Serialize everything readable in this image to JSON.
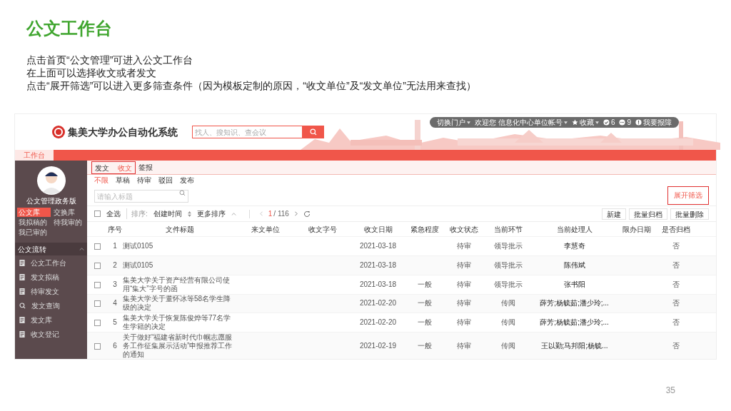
{
  "slide": {
    "title": "公文工作台",
    "lines": [
      "点击首页“公文管理”可进入公文工作台",
      "在上面可以选择收文或者发文",
      "点击“展开筛选”可以进入更多筛查条件（因为模板定制的原因，“收文单位”及“发文单位”无法用来查找）"
    ],
    "page_number": "35"
  },
  "app": {
    "logo_title": "集美大学办公自动化系统",
    "search": {
      "placeholder": "找人、搜知识、查会议"
    },
    "top_bar": [
      {
        "kind": "menu",
        "label": "切换门户"
      },
      {
        "kind": "menu",
        "label": "欢迎您 信息化中心单位帐号"
      },
      {
        "kind": "star",
        "label": "收藏"
      },
      {
        "kind": "check",
        "label": "6"
      },
      {
        "kind": "chat",
        "label": "9"
      },
      {
        "kind": "info",
        "label": "我要报障"
      }
    ],
    "nav_tabs": [
      {
        "label": "工作台",
        "selected": true
      }
    ],
    "sidebar": {
      "user_name": "公文管理政务版",
      "quick": [
        {
          "label": "公文库",
          "selected": true
        },
        {
          "label": "交换库",
          "selected": false
        },
        {
          "label": "我拟稿的",
          "selected": false
        },
        {
          "label": "待我审的",
          "selected": false
        },
        {
          "label": "我已审的",
          "selected": false
        }
      ],
      "section": {
        "label": "公文流转",
        "expanded": true
      },
      "items": [
        "公文工作台",
        "发文拟稿",
        "待审发文",
        "发文查询",
        "发文库",
        "收文登记"
      ]
    },
    "doc_tabs": [
      {
        "label": "发文",
        "selected": false
      },
      {
        "label": "收文",
        "selected": true
      },
      {
        "label": "签报",
        "selected": false
      }
    ],
    "filters": [
      {
        "label": "不限",
        "selected": true
      },
      {
        "label": "草稿",
        "selected": false
      },
      {
        "label": "待审",
        "selected": false
      },
      {
        "label": "驳回",
        "selected": false
      },
      {
        "label": "发布",
        "selected": false
      }
    ],
    "title_search": {
      "placeholder": "请输入标题"
    },
    "expand_filter": "展开筛选",
    "toolbar": {
      "select_all": {
        "label": "全选",
        "checked": false
      },
      "sort_label": "排序:",
      "sort_field": "创建时间",
      "more_sort": "更多排序",
      "page_current": "1",
      "page_total": "/ 116",
      "buttons": [
        "新建",
        "批量归档",
        "批量删除"
      ]
    },
    "table": {
      "columns": [
        "序号",
        "文件标题",
        "来文单位",
        "收文字号",
        "收文日期",
        "紧急程度",
        "收文状态",
        "当前环节",
        "当前处理人",
        "限办日期",
        "是否归档"
      ],
      "rows": [
        {
          "checked": false,
          "cells": [
            "1",
            "测试0105",
            "",
            "",
            "2021-03-18",
            "",
            "待审",
            "领导批示",
            "李慧奇",
            "",
            "否"
          ]
        },
        {
          "checked": false,
          "cells": [
            "2",
            "测试0105",
            "",
            "",
            "2021-03-18",
            "",
            "待审",
            "领导批示",
            "陈伟斌",
            "",
            "否"
          ]
        },
        {
          "checked": false,
          "cells": [
            "3",
            "集美大学关于资产经营有限公司使用“集大”字号的函",
            "",
            "",
            "2021-03-18",
            "一般",
            "待审",
            "领导批示",
            "张书阳",
            "",
            "否"
          ]
        },
        {
          "checked": false,
          "cells": [
            "4",
            "集美大学关于董怀冰等58名学生降级的决定",
            "",
            "",
            "2021-02-20",
            "一般",
            "待审",
            "传阅",
            "薛芳;杨毓茹;潘少玲;...",
            "",
            "否"
          ]
        },
        {
          "checked": false,
          "cells": [
            "5",
            "集美大学关于恢复陈俊烨等77名学生学籍的决定",
            "",
            "",
            "2021-02-20",
            "一般",
            "待审",
            "传阅",
            "薛芳;杨毓茹;潘少玲;...",
            "",
            "否"
          ]
        },
        {
          "checked": false,
          "cells": [
            "6",
            "关于做好“福建省新时代巾帼志愿服务工作征集展示活动”申报推荐工作的通知",
            "",
            "",
            "2021-02-19",
            "一般",
            "待审",
            "传阅",
            "王以勤;马邦阳;杨毓...",
            "",
            "否"
          ]
        }
      ]
    }
  }
}
